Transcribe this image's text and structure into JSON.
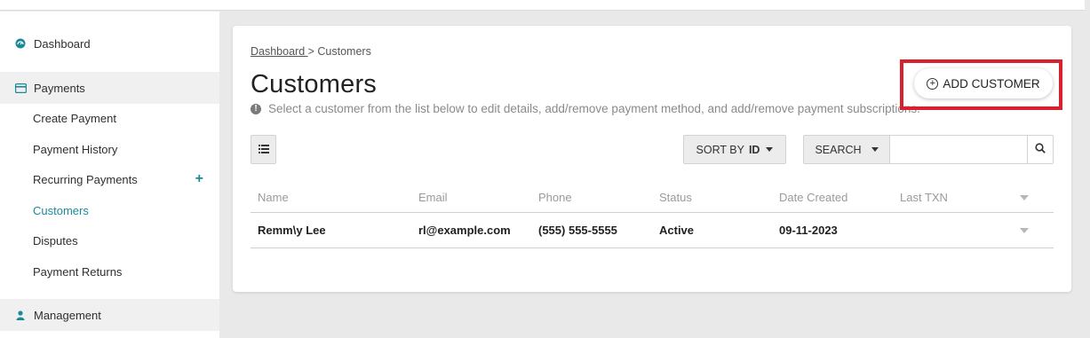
{
  "sidebar": {
    "dashboard": "Dashboard",
    "payments": "Payments",
    "payments_items": [
      "Create Payment",
      "Payment History",
      "Recurring Payments",
      "Customers",
      "Disputes",
      "Payment Returns"
    ],
    "recurring_add": "+",
    "active_item": "Customers",
    "management": "Management"
  },
  "breadcrumb": {
    "root": "Dashboard ",
    "separator": "> ",
    "current": "Customers"
  },
  "page": {
    "title": "Customers",
    "info": "Select a customer from the list below to edit details, add/remove payment method, and add/remove payment subscriptions.",
    "info_icon": "!"
  },
  "toolbar": {
    "add_customer": "ADD CUSTOMER",
    "sort_by_label": "SORT BY",
    "sort_by_value": "ID",
    "search_label": "SEARCH",
    "search_value": "",
    "search_placeholder": ""
  },
  "table": {
    "columns": [
      "Name",
      "Email",
      "Phone",
      "Status",
      "Date Created",
      "Last TXN"
    ],
    "rows": [
      {
        "name": "Remm\\y Lee",
        "email": "rl@example.com",
        "phone": "(555) 555-5555",
        "status": "Active",
        "date_created": "09-11-2023",
        "last_txn": ""
      }
    ]
  },
  "colors": {
    "accent": "#1a8a9a",
    "highlight": "#d9202f",
    "background": "#e9e9e9"
  },
  "icons": {
    "dashboard": "dashboard-icon",
    "payments": "credit-card-icon",
    "management": "person-icon",
    "list_view": "list-icon",
    "search": "search-icon",
    "add": "circle-plus-icon"
  }
}
